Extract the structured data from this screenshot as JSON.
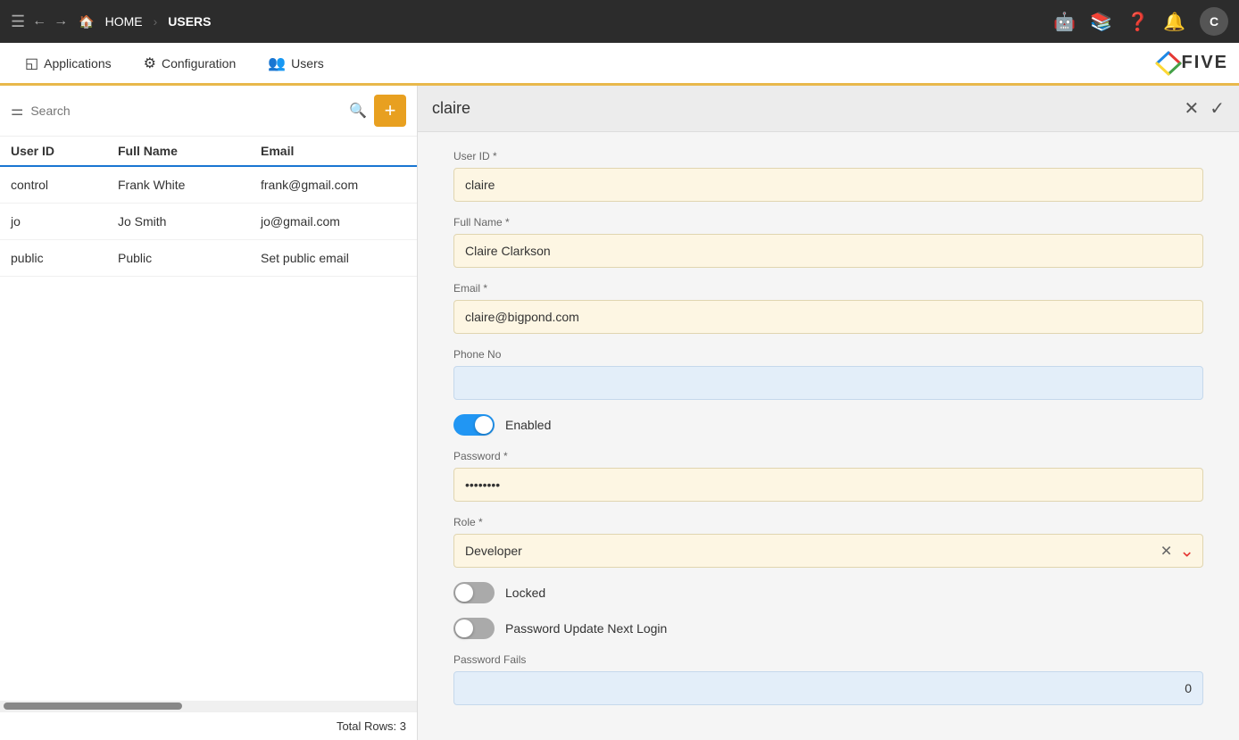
{
  "topbar": {
    "home_label": "HOME",
    "users_label": "USERS",
    "avatar_letter": "C"
  },
  "secondbar": {
    "applications_label": "Applications",
    "configuration_label": "Configuration",
    "users_label": "Users"
  },
  "left_panel": {
    "search_placeholder": "Search",
    "table": {
      "headers": {
        "user_id": "User ID",
        "full_name": "Full Name",
        "email": "Email"
      },
      "rows": [
        {
          "user_id": "control",
          "full_name": "Frank White",
          "email": "frank@gmail.com"
        },
        {
          "user_id": "jo",
          "full_name": "Jo Smith",
          "email": "jo@gmail.com"
        },
        {
          "user_id": "public",
          "full_name": "Public",
          "email": "Set public email"
        }
      ],
      "total_rows_label": "Total Rows: 3"
    }
  },
  "right_panel": {
    "title": "claire",
    "fields": {
      "user_id_label": "User ID *",
      "user_id_value": "claire",
      "full_name_label": "Full Name *",
      "full_name_value": "Claire Clarkson",
      "email_label": "Email *",
      "email_value": "claire@bigpond.com",
      "phone_label": "Phone No",
      "phone_value": "",
      "enabled_label": "Enabled",
      "password_label": "Password *",
      "password_dots": "••••••••",
      "role_label": "Role *",
      "role_value": "Developer",
      "locked_label": "Locked",
      "password_update_label": "Password Update Next Login",
      "password_fails_label": "Password Fails",
      "password_fails_value": "0"
    }
  }
}
